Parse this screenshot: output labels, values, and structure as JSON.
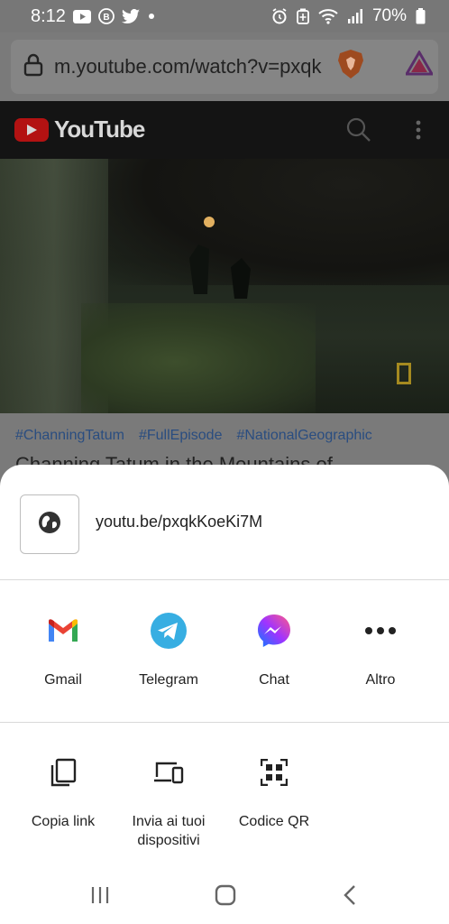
{
  "status_bar": {
    "time": "8:12",
    "battery": "70%"
  },
  "browser": {
    "url": "m.youtube.com/watch?v=pxqk"
  },
  "youtube": {
    "logo_text": "YouTube",
    "hashtags": [
      "#ChanningTatum",
      "#FullEpisode",
      "#NationalGeographic"
    ],
    "video_title": "Channing Tatum in the Mountains of..."
  },
  "share_sheet": {
    "link": "youtu.be/pxqkKoeKi7M",
    "apps": [
      {
        "label": "Gmail",
        "icon": "gmail-icon"
      },
      {
        "label": "Telegram",
        "icon": "telegram-icon"
      },
      {
        "label": "Chat",
        "icon": "messenger-icon"
      },
      {
        "label": "Altro",
        "icon": "more-icon"
      }
    ],
    "actions": [
      {
        "label": "Copia link",
        "icon": "copy-icon"
      },
      {
        "label": "Invia ai tuoi dispositivi",
        "icon": "devices-icon"
      },
      {
        "label": "Codice QR",
        "icon": "qr-code-icon"
      }
    ]
  },
  "colors": {
    "youtube_red": "#b31212",
    "hashtag": "#2a4d80",
    "telegram": "#37aee2"
  }
}
